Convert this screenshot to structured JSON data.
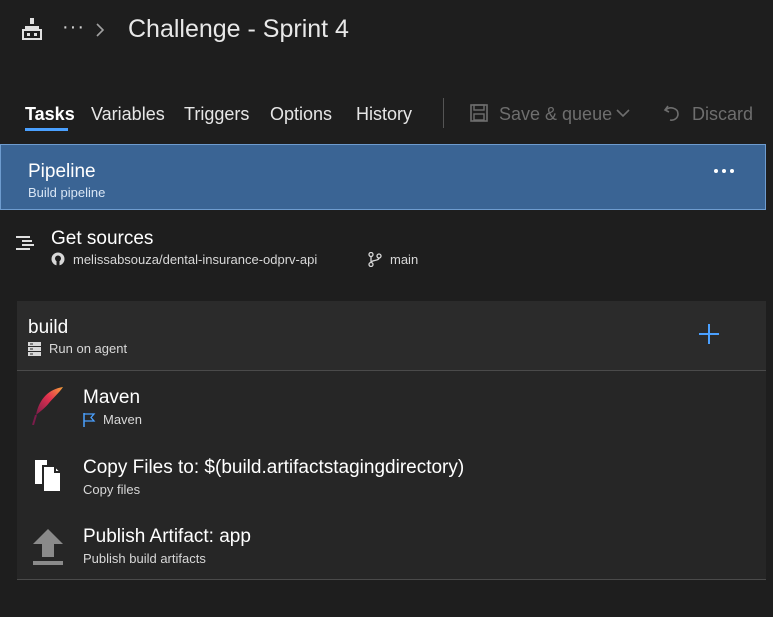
{
  "header": {
    "title": "Challenge - Sprint 4",
    "more_label": "···"
  },
  "tabs": [
    {
      "label": "Tasks",
      "active": true
    },
    {
      "label": "Variables"
    },
    {
      "label": "Triggers"
    },
    {
      "label": "Options"
    },
    {
      "label": "History"
    }
  ],
  "toolbar": {
    "save_queue_label": "Save & queue",
    "discard_label": "Discard"
  },
  "pipeline": {
    "title": "Pipeline",
    "subtitle": "Build pipeline"
  },
  "sources": {
    "title": "Get sources",
    "repository": "melissabsouza/dental-insurance-odprv-api",
    "branch": "main"
  },
  "job": {
    "title": "build",
    "subtitle": "Run on agent"
  },
  "tasks": [
    {
      "title": "Maven",
      "subtitle": "Maven",
      "icon": "maven-feather-icon"
    },
    {
      "title": "Copy Files to: $(build.artifactstagingdirectory)",
      "subtitle": "Copy files",
      "icon": "copy-files-icon"
    },
    {
      "title": "Publish Artifact: app",
      "subtitle": "Publish build artifacts",
      "icon": "upload-arrow-icon"
    }
  ],
  "colors": {
    "background": "#1e1e1e",
    "selected_row": "#3a6494",
    "accent": "#4aa0ff",
    "disabled_text": "#6e6e6e"
  }
}
